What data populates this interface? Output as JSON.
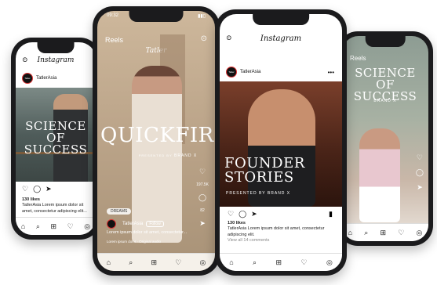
{
  "phone1": {
    "header": "Instagram",
    "account": "TatlerAsia",
    "avatar_text": "Tatler",
    "title_line1": "SCIENCE OF",
    "title_line2": "SUCCESS",
    "likes": "130 likes",
    "caption": "TatlerAsia Lorem ipsum dolor sit amet, consectetur adipiscing elit..."
  },
  "phone2": {
    "time": "09:32",
    "reels": "Reels",
    "logo": "Tatler",
    "title": "QUICKFIRE",
    "brand": "BRAND X",
    "presented": "PRESENTED BY",
    "like_count": "197.5K",
    "comment_count": "82",
    "tag": "DREAMS",
    "account": "TatlerAsia",
    "follow": "Follow",
    "caption": "Lorem ipsum dolor sit amet, consectetur...",
    "music": "Lorem ipsum dolor · Original audio"
  },
  "phone3": {
    "header": "Instagram",
    "account": "TatlerAsia",
    "avatar_text": "Tatler",
    "title_line1": "FOUNDER",
    "title_line2": "STORIES",
    "brand": "PRESENTED BY  BRAND X",
    "likes": "130 likes",
    "caption": "TatlerAsia Lorem ipsum dolor sit amet, consectetur adipiscing elit.",
    "comments": "View all 14 comments"
  },
  "phone4": {
    "reels": "Reels",
    "title_line1": "SCIENCE OF",
    "title_line2": "SUCCESS",
    "brand": "BRAND X"
  },
  "nav_icons": [
    "⌂",
    "⌕",
    "⊞",
    "♡",
    "◎"
  ]
}
